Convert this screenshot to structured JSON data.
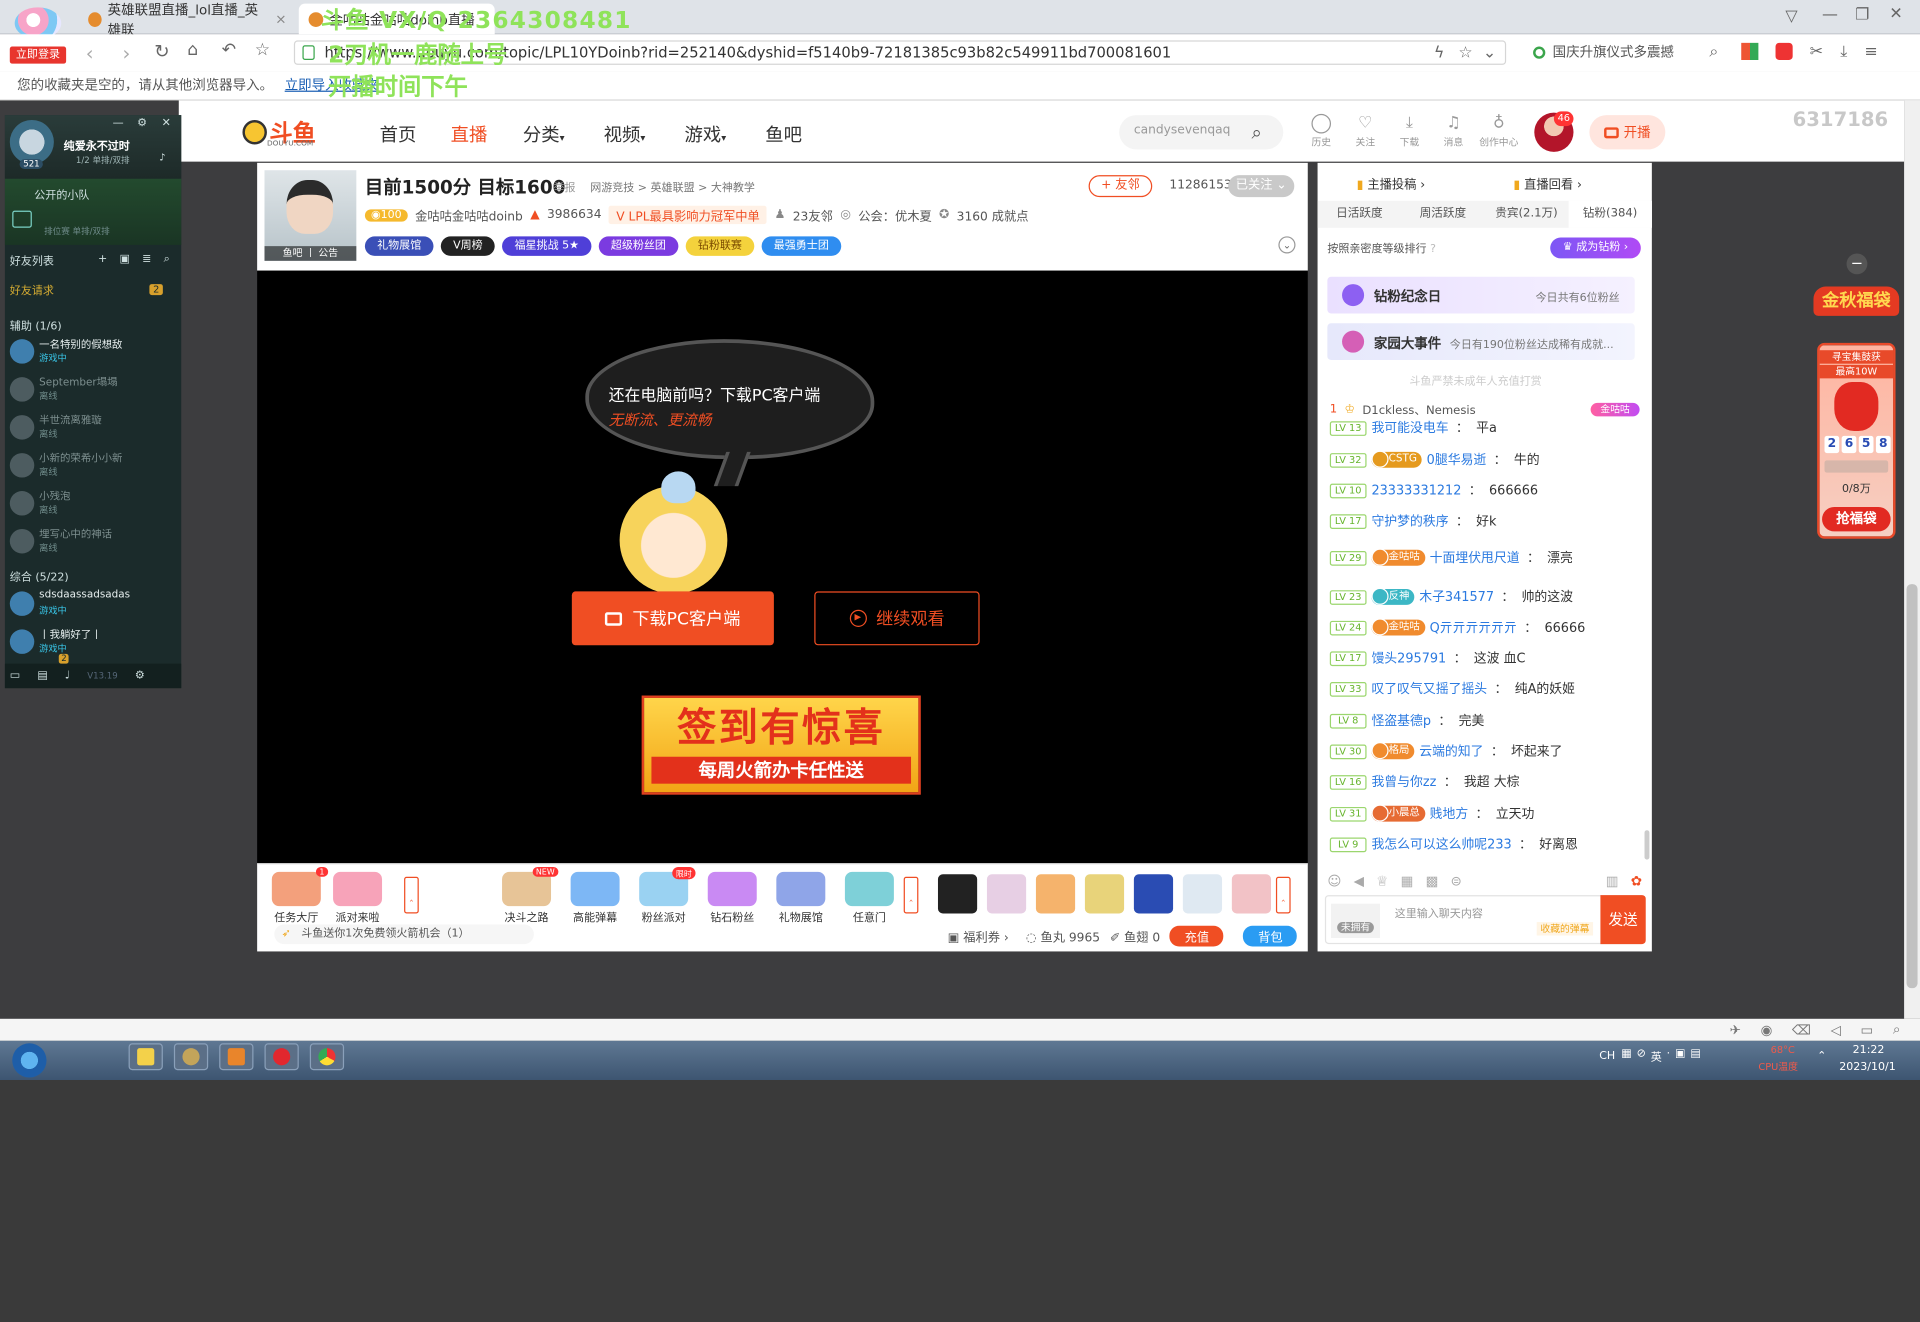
{
  "browser": {
    "login_badge": "立即登录",
    "tabs": [
      {
        "label": "英雄联盟直播_lol直播_英雄联",
        "close": "×"
      },
      {
        "label": "金咕咕金咕咕doinb直播"
      }
    ],
    "url": "https://www.douyu.com/topic/LPL10YDoinb?rid=252140&dyshid=f5140b9-72181385c93b82c549911bd700081601",
    "search_suggest": "国庆升旗仪式多震撼",
    "bookmark_text": "您的收藏夹是空的，请从其他浏览器导入。",
    "bookmark_link": "立即导入收藏夹"
  },
  "overlay": {
    "line1": "斗鱼 VX/Q 2364308481",
    "line2": "2刀机一鹿随上号",
    "line3": "开播时间下午",
    "counter": "6317186"
  },
  "qq": {
    "username": "纯爱永不过时",
    "level": "521",
    "status": "1/2 单排/双排",
    "group_title": "公开的小队",
    "group_sub": "排位赛 单排/双排",
    "friends_title": "好友列表",
    "requests_label": "好友请求",
    "requests_count": "2",
    "section1": "辅助 (1/6)",
    "section2": "综合 (5/22)",
    "friends1": [
      {
        "name": "一名特别的假想敌",
        "status": "游戏中",
        "online": true
      },
      {
        "name": "September塌塌",
        "status": "离线",
        "online": false
      },
      {
        "name": "半世流离雅璇",
        "status": "离线",
        "online": false
      },
      {
        "name": "小新的荣希小小新",
        "status": "离线",
        "online": false
      },
      {
        "name": "小残泡",
        "status": "离线",
        "online": false
      },
      {
        "name": "埋写心中的神话",
        "status": "离线",
        "online": false
      }
    ],
    "friends2": [
      {
        "name": "sdsdaassadsadas",
        "status": "游戏中",
        "online": true
      },
      {
        "name": "丨我躺好了丨",
        "status": "游戏中",
        "online": true
      }
    ],
    "bottom_badge": "2",
    "version": "V13.19"
  },
  "site": {
    "logo": "斗鱼",
    "logo_sub": "DOUYU.COM",
    "nav": [
      "首页",
      "直播",
      "分类",
      "视频",
      "游戏",
      "鱼吧"
    ],
    "search_placeholder": "candysevenqaq",
    "top_icons": [
      "历史",
      "关注",
      "下载",
      "消息",
      "创作中心"
    ],
    "avatar_badge": "46",
    "live_button": "开播"
  },
  "room": {
    "title": "目前1500分 目标1600",
    "report": "举报",
    "breadcrumb": "网游竞技 > 英雄联盟 > 大神教学",
    "friend_button": "+ 友邻",
    "followers": "11286153",
    "follow_state": "已关注",
    "level_badge": "100",
    "streamer": "金咕咕金咕咕doinb",
    "heat": "3986634",
    "tag": "LPL最具影响力冠军中单",
    "friends": "23友邻",
    "guild": "公会：优木夏",
    "achievements": "3160 成就点",
    "thumb_tag": "鱼吧 丨 公告",
    "chips": [
      "礼物展馆",
      "V周榜",
      "福星挑战 5★",
      "超级粉丝团",
      "钻粉联赛",
      "最强勇士团"
    ]
  },
  "player": {
    "bubble_line1": "还在电脑前吗？下载PC客户端",
    "bubble_line2": "无断流、更流畅",
    "download_btn": "下载PC客户端",
    "continue_btn": "继续观看",
    "banner_line1": "签到有惊喜",
    "banner_line2": "每周火箭办卡任性送"
  },
  "gifts": {
    "left": [
      {
        "label": "任务大厅",
        "badge": "1"
      },
      {
        "label": "派对来啦",
        "badge": ""
      }
    ],
    "right": [
      {
        "label": "决斗之路",
        "badge": "NEW"
      },
      {
        "label": "高能弹幕",
        "badge": ""
      },
      {
        "label": "粉丝派对",
        "badge": "限时"
      },
      {
        "label": "钻石粉丝",
        "badge": ""
      },
      {
        "label": "礼物展馆",
        "badge": ""
      },
      {
        "label": "任意门",
        "badge": ""
      }
    ],
    "notice": "斗鱼送你1次免费领火箭机会（1）",
    "welfare": "福利券",
    "fishball": "鱼丸 9965",
    "fishfin": "鱼翅 0",
    "recharge": "充值",
    "backpack": "背包"
  },
  "chat": {
    "tab_a": "主播投稿",
    "tab_b": "直播回看",
    "rank_tabs": [
      "日活跃度",
      "周活跃度",
      "贵宾(2.1万)",
      "钻粉(384)"
    ],
    "rank_sort": "按照亲密度等级排行",
    "become_diamond": "成为钻粉",
    "notice1_title": "钻粉纪念日",
    "notice1_text": "今日共有6位粉丝",
    "notice2_title": "家园大事件",
    "notice2_text": "今日有190位粉丝达成稀有成就...",
    "minor_notice": "斗鱼严禁未成年人充值打赏",
    "top_rank": {
      "num": "1",
      "name": "D1ckless、Nemesis",
      "fan": "金咕咕"
    },
    "messages": [
      {
        "lv": "LV 13",
        "fan": "",
        "fancolor": "",
        "user": "我可能没电车",
        "text": "平a"
      },
      {
        "lv": "LV 32",
        "fan": "CSTG",
        "fancolor": "#e59a1e",
        "user": "0腿华易逝",
        "text": "牛的"
      },
      {
        "lv": "LV 10",
        "fan": "",
        "fancolor": "",
        "user": "23333331212",
        "text": "666666"
      },
      {
        "lv": "LV 17",
        "fan": "",
        "fancolor": "",
        "user": "守护梦的秩序",
        "text": "好k"
      },
      {
        "lv": "LV 29",
        "fan": "金咕咕",
        "fancolor": "#f08b2e",
        "user": "十面埋伏甩尺道",
        "text": "漂亮"
      },
      {
        "lv": "LV 23",
        "fan": "反神",
        "fancolor": "#3cb7c5",
        "user": "木子341577",
        "text": "帅的这波"
      },
      {
        "lv": "LV 24",
        "fan": "金咕咕",
        "fancolor": "#f08b2e",
        "user": "Q亓亓亓亓亓亓",
        "text": "66666"
      },
      {
        "lv": "LV 17",
        "fan": "",
        "fancolor": "",
        "user": "馒头295791",
        "text": "这波 血C"
      },
      {
        "lv": "LV 33",
        "fan": "",
        "fancolor": "",
        "user": "叹了叹气又摇了摇头",
        "text": "纯A的妖姬"
      },
      {
        "lv": "LV 8",
        "fan": "",
        "fancolor": "",
        "user": "怪盗基德p",
        "text": "完美"
      },
      {
        "lv": "LV 30",
        "fan": "格局",
        "fancolor": "#f08b2e",
        "user": "云端的知了",
        "text": "坏起来了"
      },
      {
        "lv": "LV 16",
        "fan": "",
        "fancolor": "",
        "user": "我曾与你zz",
        "text": "我超 大棕"
      },
      {
        "lv": "LV 31",
        "fan": "小晨总",
        "fancolor": "#e66b33",
        "user": "贱地方",
        "text": "立天功"
      },
      {
        "lv": "LV 9",
        "fan": "",
        "fancolor": "",
        "user": "我怎么可以这么帅呢233",
        "text": "好离恩"
      }
    ],
    "input_placeholder": "这里输入聊天内容",
    "danmu_hint": "收藏的弹幕",
    "not_owned": "未拥有",
    "send": "发送"
  },
  "promo": {
    "title": "金秋福袋",
    "sub": "寻宝集鼓获",
    "prize": "最高10W",
    "timer": [
      "2",
      "6",
      "5",
      "8"
    ],
    "progress": "0/8万",
    "progress_fraction": 0,
    "grab": "抢福袋"
  },
  "taskbar": {
    "lang": "CH",
    "ime": "英",
    "temp": "68°C",
    "temp_label": "CPU温度",
    "time": "21:22",
    "date": "2023/10/1"
  }
}
